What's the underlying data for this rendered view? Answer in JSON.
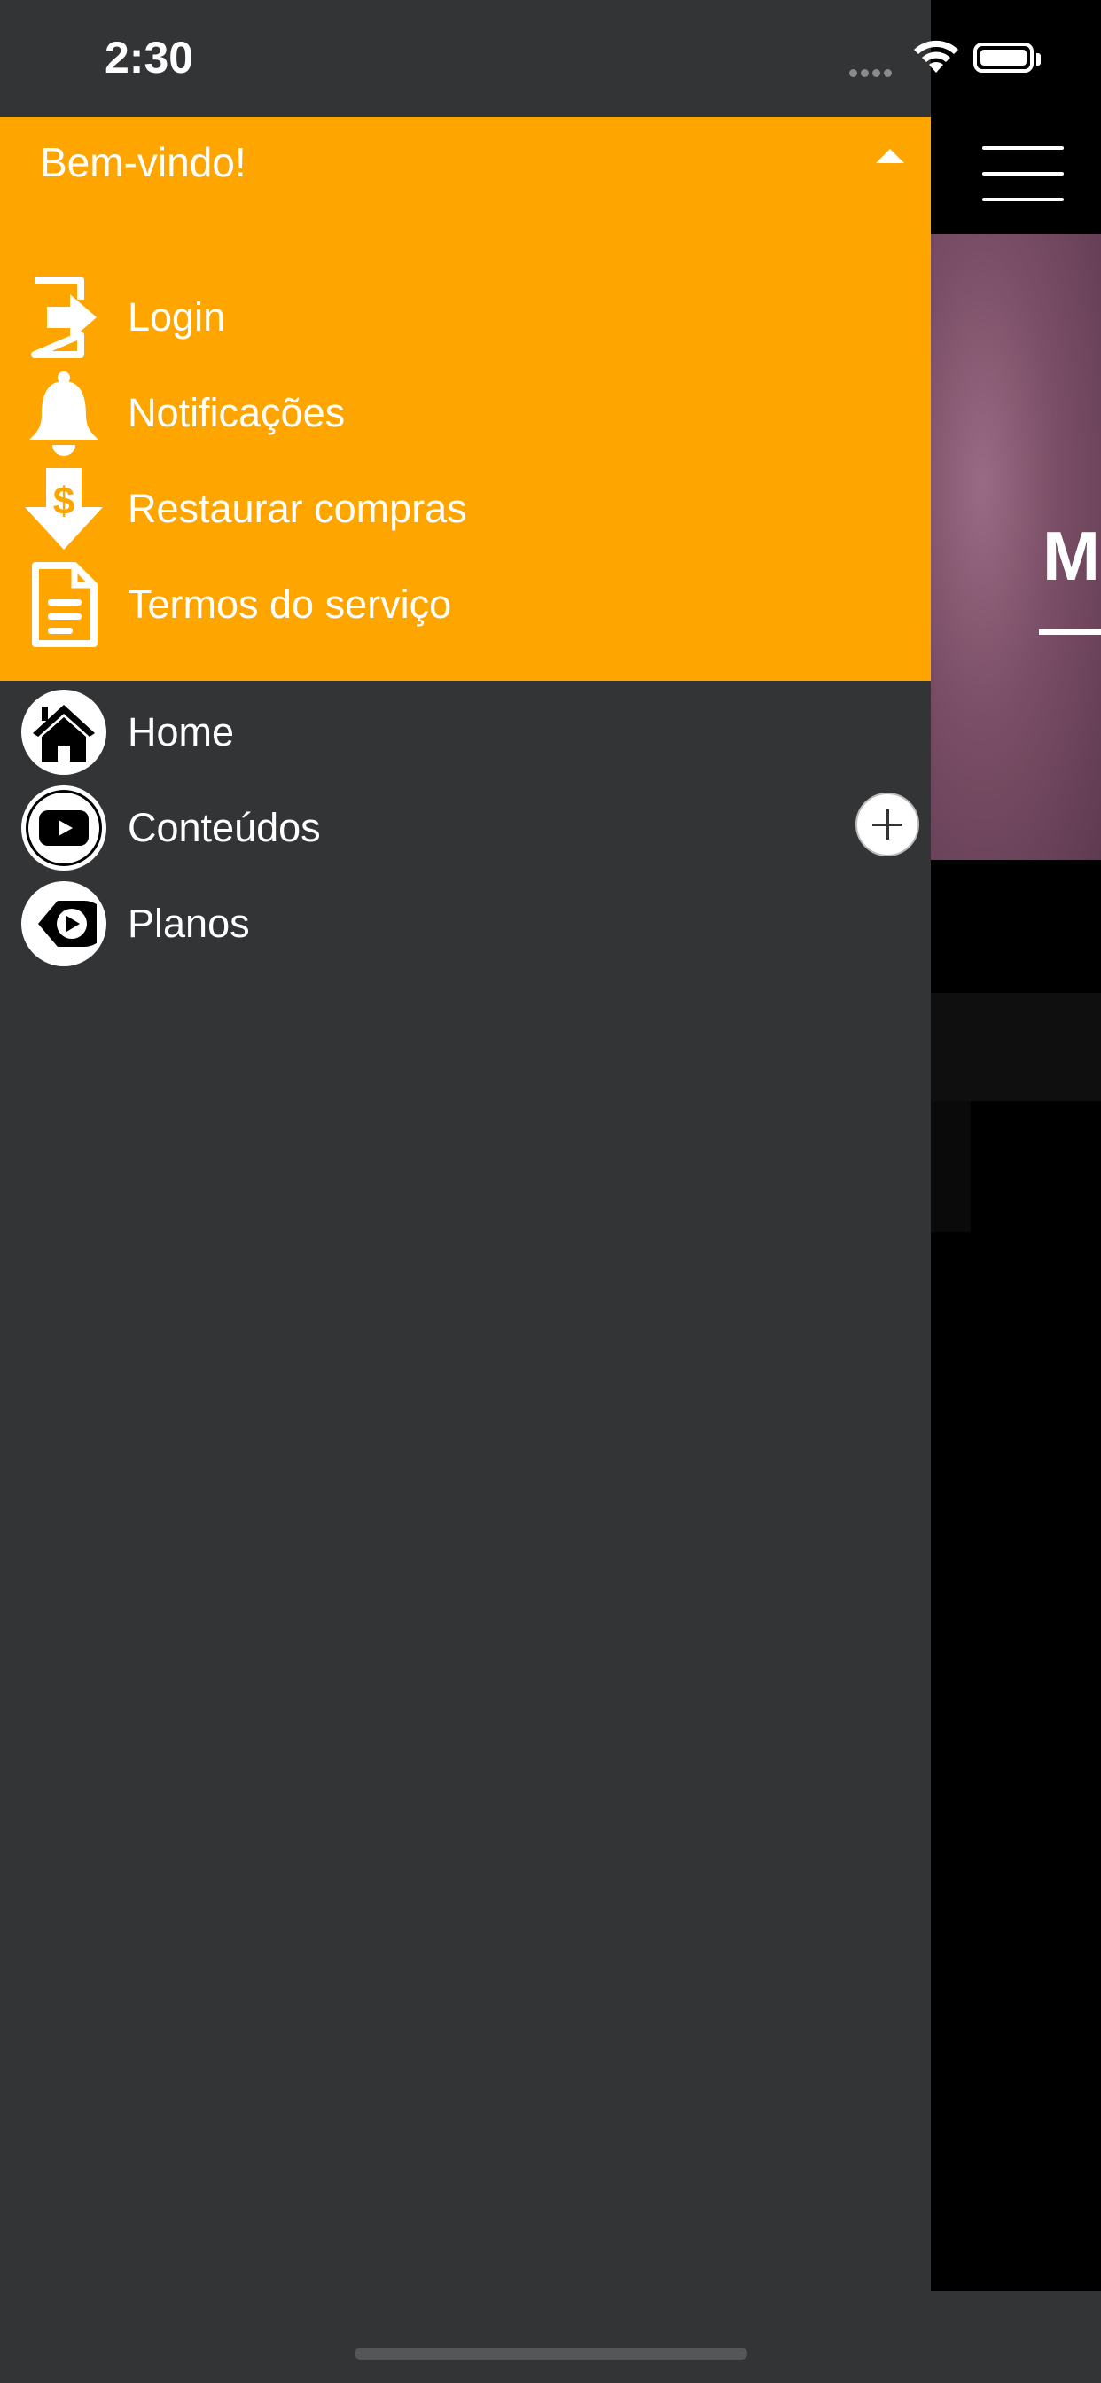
{
  "status_bar": {
    "time": "2:30"
  },
  "drawer": {
    "header": {
      "title": "Bem-vindo!",
      "background_color": "#FFA500",
      "items": [
        {
          "label": "Login",
          "icon": "login-icon"
        },
        {
          "label": "Notificações",
          "icon": "bell-icon"
        },
        {
          "label": "Restaurar compras",
          "icon": "restore-purchases-icon"
        },
        {
          "label": "Termos do serviço",
          "icon": "document-icon"
        }
      ]
    },
    "nav_items": [
      {
        "label": "Home",
        "icon": "home-icon"
      },
      {
        "label": "Conteúdos",
        "icon": "youtube-play-icon",
        "expandable": true
      },
      {
        "label": "Planos",
        "icon": "play-circle-icon"
      }
    ],
    "background_color": "#333436"
  },
  "background_app": {
    "hero_visible_text": "M"
  }
}
